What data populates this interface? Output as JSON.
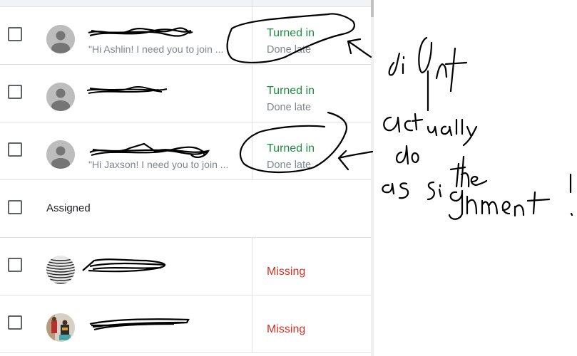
{
  "students": [
    {
      "name_redacted": true,
      "preview": "\"Hi Ashlin! I need you to join ...",
      "status": "Turned in",
      "status_sub": "Done late",
      "status_type": "turned",
      "avatar": "default-person-icon"
    },
    {
      "name_redacted": true,
      "preview": "",
      "status": "Turned in",
      "status_sub": "Done late",
      "status_type": "turned",
      "avatar": "default-person-icon"
    },
    {
      "name_redacted": true,
      "preview": "\"Hi Jaxson! I need you to join ...",
      "status": "Turned in",
      "status_sub": "Done late",
      "status_type": "turned",
      "avatar": "default-person-icon"
    }
  ],
  "section": {
    "label": "Assigned"
  },
  "assigned_students": [
    {
      "name_redacted": true,
      "status": "Missing",
      "status_type": "missing",
      "avatar": "pattern-photo"
    },
    {
      "name_redacted": true,
      "status": "Missing",
      "status_type": "missing",
      "avatar": "photo"
    }
  ],
  "annotation": {
    "handwritten_text": "didnt actually do the assignment!",
    "lines": [
      "didnt",
      "actually",
      "do",
      "the",
      "assignment!"
    ]
  },
  "colors": {
    "turned_in": "#1e8e3e",
    "missing": "#d93025",
    "muted": "#80868b",
    "ink": "#000000"
  }
}
